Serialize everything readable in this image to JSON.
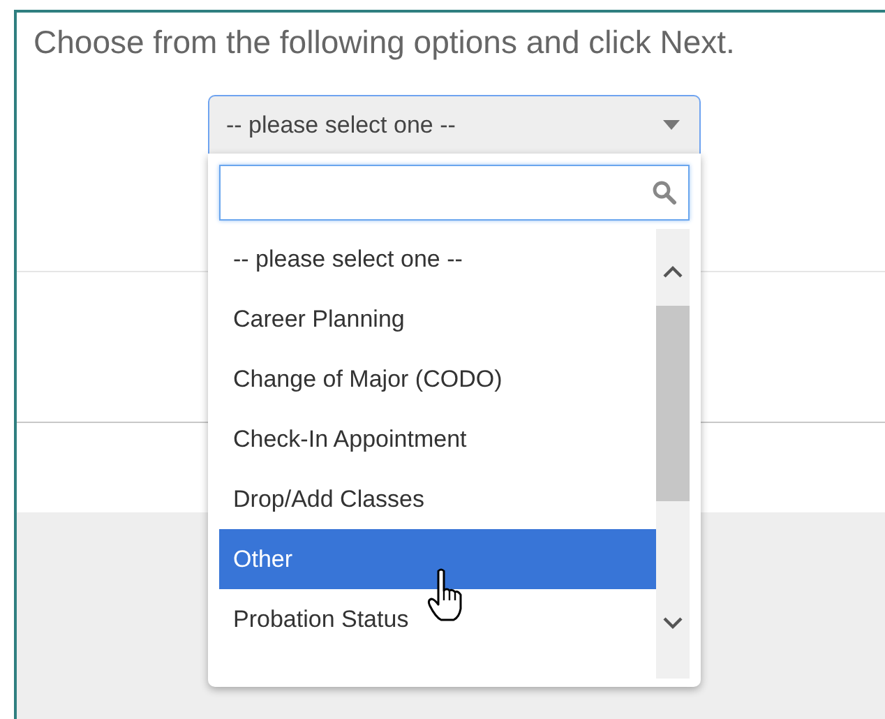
{
  "instruction": "Choose from the following options and click Next.",
  "select": {
    "value": "-- please select one --",
    "expanded": true
  },
  "options": [
    {
      "label": "-- please select one --",
      "selected": false
    },
    {
      "label": "Career Planning",
      "selected": false
    },
    {
      "label": "Change of Major (CODO)",
      "selected": false
    },
    {
      "label": "Check-In Appointment",
      "selected": false
    },
    {
      "label": "Drop/Add Classes",
      "selected": false
    },
    {
      "label": "Other",
      "selected": true
    },
    {
      "label": "Probation Status",
      "selected": false
    }
  ]
}
